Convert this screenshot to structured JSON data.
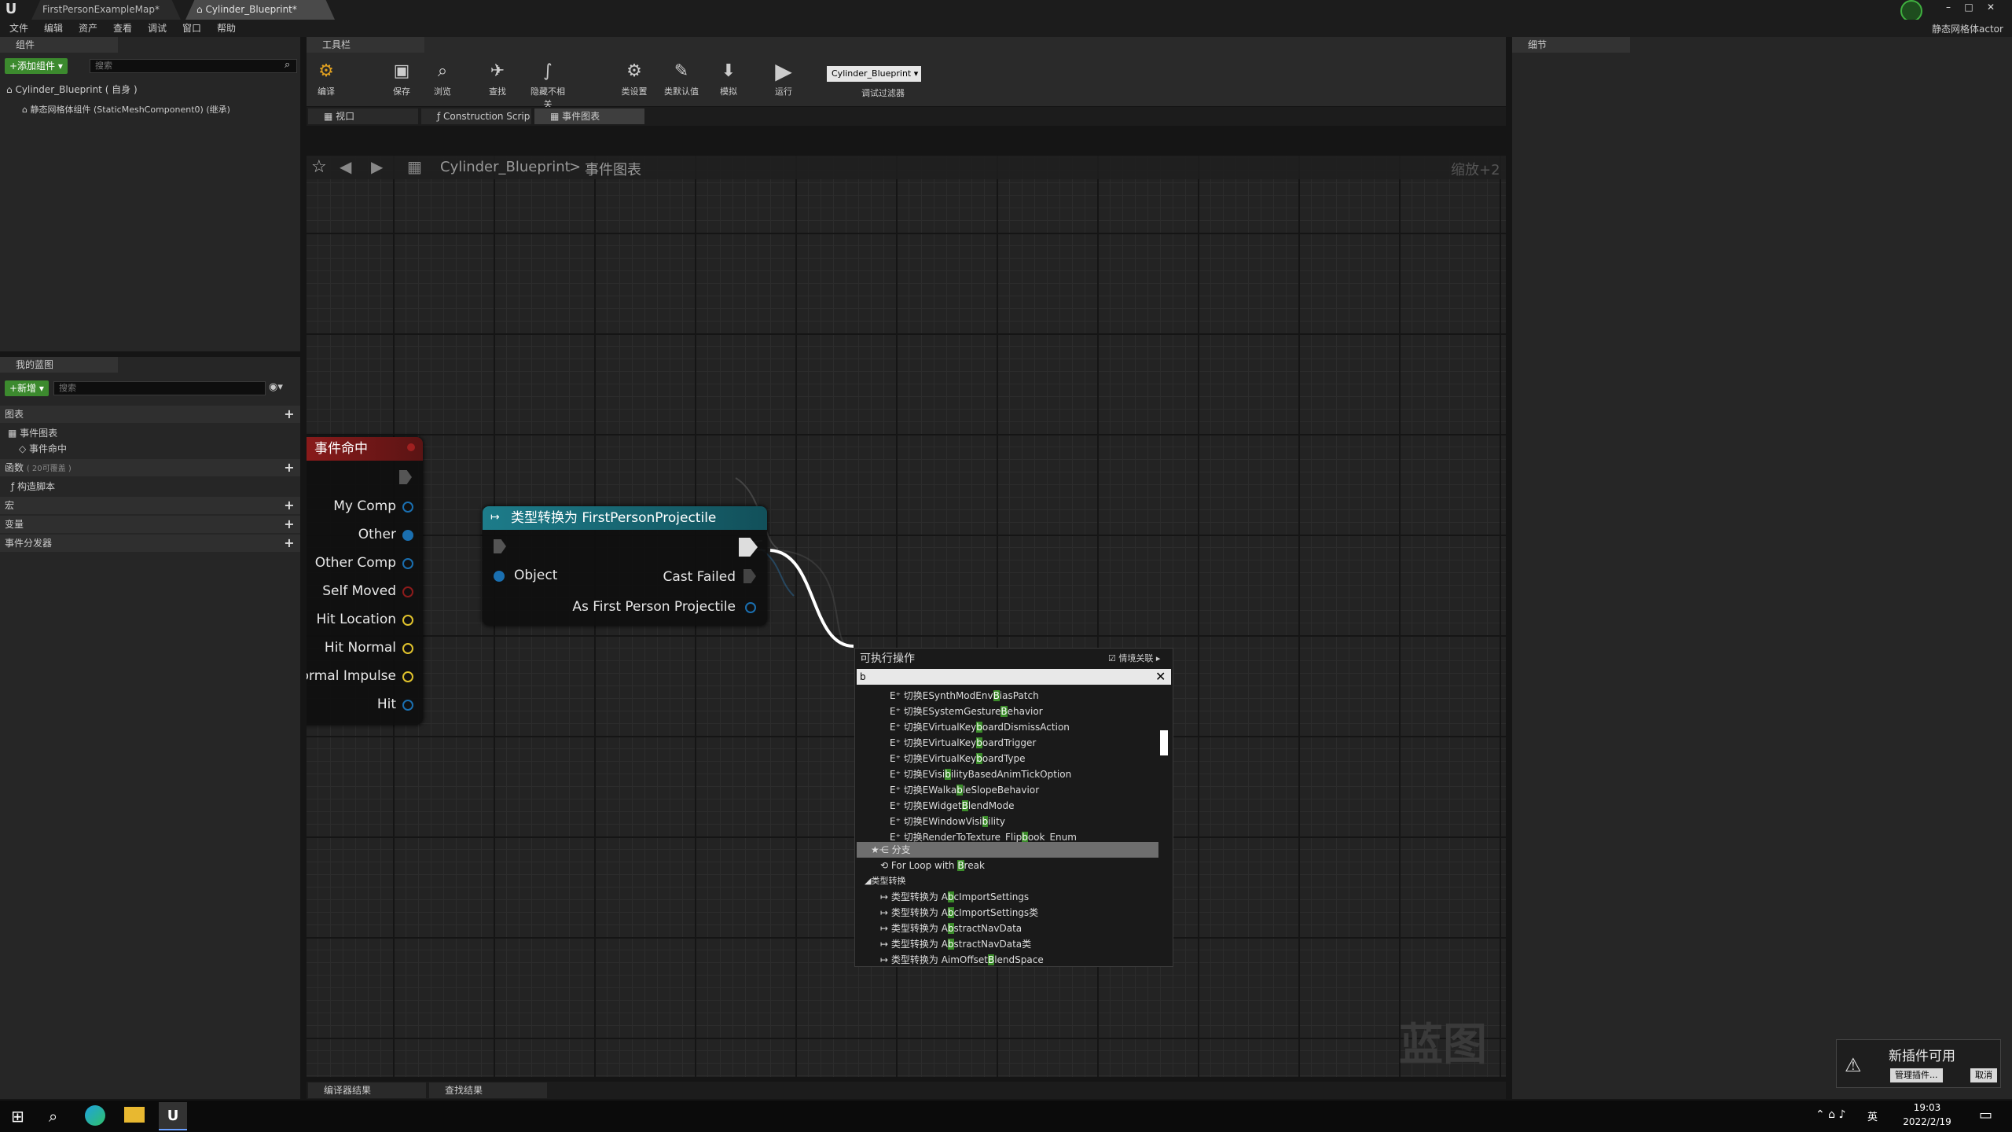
{
  "title_bar": {
    "tabs": [
      {
        "label": "FirstPersonExampleMap*"
      },
      {
        "label": "Cylinder_Blueprint*"
      }
    ],
    "top_right_label": "静态网格体actor",
    "window_buttons": [
      "–",
      "□",
      "✕"
    ]
  },
  "menu": {
    "items": [
      "文件",
      "编辑",
      "资产",
      "查看",
      "调试",
      "窗口",
      "帮助"
    ]
  },
  "components_panel": {
    "tab": "组件",
    "add_button": "+添加组件 ▾",
    "search_placeholder": "搜索",
    "tree": [
      {
        "label": "Cylinder_Blueprint ( 自身 )"
      },
      {
        "label": "静态网格体组件 (StaticMeshComponent0) (继承)"
      }
    ]
  },
  "my_blueprint": {
    "tab": "我的蓝图",
    "new_button": "+新增 ▾",
    "search_placeholder": "搜索",
    "graphs_header": "图表",
    "event_graph": "事件图表",
    "event_item": "事件命中",
    "functions_header": "函数",
    "functions_override": "( 20可覆盖 )",
    "construction_script": "构造脚本",
    "macros": "宏",
    "variables": "变量",
    "event_dispatchers": "事件分发器"
  },
  "toolbar": {
    "tab": "工具栏",
    "buttons": [
      {
        "label": "编译",
        "icon": "compile-icon"
      },
      {
        "label": "保存",
        "icon": "save-icon"
      },
      {
        "label": "浏览",
        "icon": "browse-icon"
      },
      {
        "label": "查找",
        "icon": "find-icon"
      },
      {
        "label": "隐藏不相关",
        "icon": "hide-unrelated-icon"
      },
      {
        "label": "类设置",
        "icon": "class-settings-icon"
      },
      {
        "label": "类默认值",
        "icon": "class-defaults-icon"
      },
      {
        "label": "模拟",
        "icon": "simulate-icon"
      },
      {
        "label": "运行",
        "icon": "play-icon"
      }
    ],
    "debug_select": "Cylinder_Blueprint",
    "debug_filter_label": "调试过滤器"
  },
  "editor_tabs": [
    {
      "label": "视口"
    },
    {
      "label": "Construction Scrip"
    },
    {
      "label": "事件图表"
    }
  ],
  "breadcrumb": {
    "blueprint": "Cylinder_Blueprint",
    "separator": ">",
    "graph": "事件图表",
    "zoom": "缩放+2"
  },
  "details_panel": {
    "tab": "细节"
  },
  "event_node": {
    "title": "事件命中",
    "pins": [
      "My Comp",
      "Other",
      "Other Comp",
      "Self Moved",
      "Hit Location",
      "Hit Normal",
      "Normal Impulse",
      "Hit"
    ]
  },
  "cast_node": {
    "title": "类型转换为 FirstPersonProjectile",
    "input": "Object",
    "cast_failed": "Cast Failed",
    "output": "As First Person Projectile"
  },
  "context_menu": {
    "title": "可执行操作",
    "context_sensitive": "情境关联",
    "search_value": "b",
    "items": [
      {
        "pre": "切换ESynthModEnv",
        "hl": "B",
        "post": "iasPatch"
      },
      {
        "pre": "切换ESystemGesture",
        "hl": "B",
        "post": "ehavior"
      },
      {
        "pre": "切换EVirtualKey",
        "hl": "b",
        "post": "oardDismissAction"
      },
      {
        "pre": "切换EVirtualKey",
        "hl": "b",
        "post": "oardTrigger"
      },
      {
        "pre": "切换EVirtualKey",
        "hl": "b",
        "post": "oardType"
      },
      {
        "pre": "切换EVisi",
        "hl": "b",
        "post": "ilityBasedAnimTickOption"
      },
      {
        "pre": "切换EWalka",
        "hl": "b",
        "post": "leSlopeBehavior"
      },
      {
        "pre": "切换EWidget",
        "hl": "B",
        "post": "lendMode"
      },
      {
        "pre": "切换EWindowVisi",
        "hl": "b",
        "post": "ility"
      },
      {
        "pre": "切换RenderToTexture_Flip",
        "hl": "b",
        "post": "ook_Enum"
      }
    ],
    "selected": "分支",
    "for_loop": {
      "pre": "For Loop with ",
      "hl": "B",
      "post": "reak"
    },
    "category": "类型转换",
    "cast_items": [
      {
        "pre": "类型转换为 A",
        "hl": "b",
        "post": "cImportSettings"
      },
      {
        "pre": "类型转换为 A",
        "hl": "b",
        "post": "cImportSettings类"
      },
      {
        "pre": "类型转换为 A",
        "hl": "b",
        "post": "stractNavData"
      },
      {
        "pre": "类型转换为 A",
        "hl": "b",
        "post": "stractNavData类"
      },
      {
        "pre": "类型转换为 AimOffset",
        "hl": "B",
        "post": "lendSpace"
      }
    ]
  },
  "watermark": "蓝图",
  "bottom_tabs": [
    {
      "label": "编译器结果"
    },
    {
      "label": "查找结果"
    }
  ],
  "notification": {
    "title": "新插件可用",
    "manage": "管理插件...",
    "cancel": "取消"
  },
  "taskbar": {
    "time": "19:03",
    "date": "2022/2/19",
    "ime": "英"
  },
  "colors": {
    "event_red": "#8c1b1b",
    "cast_teal": "#1d7c8a",
    "highlight_green": "#3b8c2a",
    "pin_blue": "#1a6fb0",
    "pin_yellow": "#e0c22c"
  }
}
